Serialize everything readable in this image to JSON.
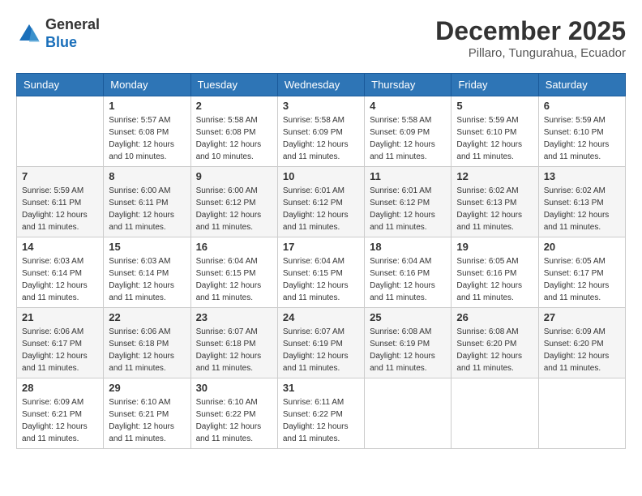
{
  "logo": {
    "general": "General",
    "blue": "Blue"
  },
  "header": {
    "month_year": "December 2025",
    "location": "Pillaro, Tungurahua, Ecuador"
  },
  "weekdays": [
    "Sunday",
    "Monday",
    "Tuesday",
    "Wednesday",
    "Thursday",
    "Friday",
    "Saturday"
  ],
  "weeks": [
    [
      {
        "day": "",
        "sunrise": "",
        "sunset": "",
        "daylight": ""
      },
      {
        "day": "1",
        "sunrise": "Sunrise: 5:57 AM",
        "sunset": "Sunset: 6:08 PM",
        "daylight": "Daylight: 12 hours and 10 minutes."
      },
      {
        "day": "2",
        "sunrise": "Sunrise: 5:58 AM",
        "sunset": "Sunset: 6:08 PM",
        "daylight": "Daylight: 12 hours and 10 minutes."
      },
      {
        "day": "3",
        "sunrise": "Sunrise: 5:58 AM",
        "sunset": "Sunset: 6:09 PM",
        "daylight": "Daylight: 12 hours and 11 minutes."
      },
      {
        "day": "4",
        "sunrise": "Sunrise: 5:58 AM",
        "sunset": "Sunset: 6:09 PM",
        "daylight": "Daylight: 12 hours and 11 minutes."
      },
      {
        "day": "5",
        "sunrise": "Sunrise: 5:59 AM",
        "sunset": "Sunset: 6:10 PM",
        "daylight": "Daylight: 12 hours and 11 minutes."
      },
      {
        "day": "6",
        "sunrise": "Sunrise: 5:59 AM",
        "sunset": "Sunset: 6:10 PM",
        "daylight": "Daylight: 12 hours and 11 minutes."
      }
    ],
    [
      {
        "day": "7",
        "sunrise": "Sunrise: 5:59 AM",
        "sunset": "Sunset: 6:11 PM",
        "daylight": "Daylight: 12 hours and 11 minutes."
      },
      {
        "day": "8",
        "sunrise": "Sunrise: 6:00 AM",
        "sunset": "Sunset: 6:11 PM",
        "daylight": "Daylight: 12 hours and 11 minutes."
      },
      {
        "day": "9",
        "sunrise": "Sunrise: 6:00 AM",
        "sunset": "Sunset: 6:12 PM",
        "daylight": "Daylight: 12 hours and 11 minutes."
      },
      {
        "day": "10",
        "sunrise": "Sunrise: 6:01 AM",
        "sunset": "Sunset: 6:12 PM",
        "daylight": "Daylight: 12 hours and 11 minutes."
      },
      {
        "day": "11",
        "sunrise": "Sunrise: 6:01 AM",
        "sunset": "Sunset: 6:12 PM",
        "daylight": "Daylight: 12 hours and 11 minutes."
      },
      {
        "day": "12",
        "sunrise": "Sunrise: 6:02 AM",
        "sunset": "Sunset: 6:13 PM",
        "daylight": "Daylight: 12 hours and 11 minutes."
      },
      {
        "day": "13",
        "sunrise": "Sunrise: 6:02 AM",
        "sunset": "Sunset: 6:13 PM",
        "daylight": "Daylight: 12 hours and 11 minutes."
      }
    ],
    [
      {
        "day": "14",
        "sunrise": "Sunrise: 6:03 AM",
        "sunset": "Sunset: 6:14 PM",
        "daylight": "Daylight: 12 hours and 11 minutes."
      },
      {
        "day": "15",
        "sunrise": "Sunrise: 6:03 AM",
        "sunset": "Sunset: 6:14 PM",
        "daylight": "Daylight: 12 hours and 11 minutes."
      },
      {
        "day": "16",
        "sunrise": "Sunrise: 6:04 AM",
        "sunset": "Sunset: 6:15 PM",
        "daylight": "Daylight: 12 hours and 11 minutes."
      },
      {
        "day": "17",
        "sunrise": "Sunrise: 6:04 AM",
        "sunset": "Sunset: 6:15 PM",
        "daylight": "Daylight: 12 hours and 11 minutes."
      },
      {
        "day": "18",
        "sunrise": "Sunrise: 6:04 AM",
        "sunset": "Sunset: 6:16 PM",
        "daylight": "Daylight: 12 hours and 11 minutes."
      },
      {
        "day": "19",
        "sunrise": "Sunrise: 6:05 AM",
        "sunset": "Sunset: 6:16 PM",
        "daylight": "Daylight: 12 hours and 11 minutes."
      },
      {
        "day": "20",
        "sunrise": "Sunrise: 6:05 AM",
        "sunset": "Sunset: 6:17 PM",
        "daylight": "Daylight: 12 hours and 11 minutes."
      }
    ],
    [
      {
        "day": "21",
        "sunrise": "Sunrise: 6:06 AM",
        "sunset": "Sunset: 6:17 PM",
        "daylight": "Daylight: 12 hours and 11 minutes."
      },
      {
        "day": "22",
        "sunrise": "Sunrise: 6:06 AM",
        "sunset": "Sunset: 6:18 PM",
        "daylight": "Daylight: 12 hours and 11 minutes."
      },
      {
        "day": "23",
        "sunrise": "Sunrise: 6:07 AM",
        "sunset": "Sunset: 6:18 PM",
        "daylight": "Daylight: 12 hours and 11 minutes."
      },
      {
        "day": "24",
        "sunrise": "Sunrise: 6:07 AM",
        "sunset": "Sunset: 6:19 PM",
        "daylight": "Daylight: 12 hours and 11 minutes."
      },
      {
        "day": "25",
        "sunrise": "Sunrise: 6:08 AM",
        "sunset": "Sunset: 6:19 PM",
        "daylight": "Daylight: 12 hours and 11 minutes."
      },
      {
        "day": "26",
        "sunrise": "Sunrise: 6:08 AM",
        "sunset": "Sunset: 6:20 PM",
        "daylight": "Daylight: 12 hours and 11 minutes."
      },
      {
        "day": "27",
        "sunrise": "Sunrise: 6:09 AM",
        "sunset": "Sunset: 6:20 PM",
        "daylight": "Daylight: 12 hours and 11 minutes."
      }
    ],
    [
      {
        "day": "28",
        "sunrise": "Sunrise: 6:09 AM",
        "sunset": "Sunset: 6:21 PM",
        "daylight": "Daylight: 12 hours and 11 minutes."
      },
      {
        "day": "29",
        "sunrise": "Sunrise: 6:10 AM",
        "sunset": "Sunset: 6:21 PM",
        "daylight": "Daylight: 12 hours and 11 minutes."
      },
      {
        "day": "30",
        "sunrise": "Sunrise: 6:10 AM",
        "sunset": "Sunset: 6:22 PM",
        "daylight": "Daylight: 12 hours and 11 minutes."
      },
      {
        "day": "31",
        "sunrise": "Sunrise: 6:11 AM",
        "sunset": "Sunset: 6:22 PM",
        "daylight": "Daylight: 12 hours and 11 minutes."
      },
      {
        "day": "",
        "sunrise": "",
        "sunset": "",
        "daylight": ""
      },
      {
        "day": "",
        "sunrise": "",
        "sunset": "",
        "daylight": ""
      },
      {
        "day": "",
        "sunrise": "",
        "sunset": "",
        "daylight": ""
      }
    ]
  ]
}
